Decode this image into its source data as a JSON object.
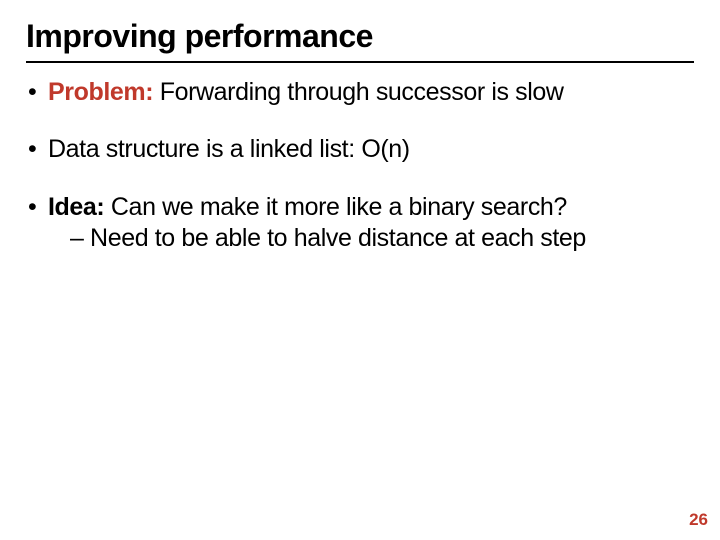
{
  "title": "Improving performance",
  "bullets": {
    "b1": {
      "label": "Problem:",
      "text": " Forwarding through successor is slow"
    },
    "b2": {
      "text": "Data structure is a linked list: O(n)"
    },
    "b3": {
      "label": "Idea:",
      "text": " Can we make it more like a binary search?",
      "sub": "– Need to be able to halve distance at each step"
    }
  },
  "page_number": "26"
}
